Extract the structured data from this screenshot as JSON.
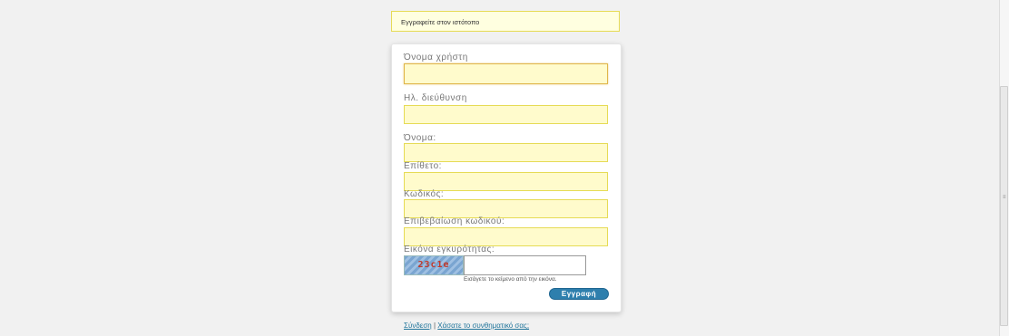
{
  "notice": {
    "text": "Εγγραφείτε στον ιστότοπο"
  },
  "form": {
    "username": {
      "label": "Όνομα χρήστη",
      "value": ""
    },
    "email": {
      "label": "Ηλ. διεύθυνση",
      "value": ""
    },
    "first_name": {
      "label": "Όνομα:",
      "value": ""
    },
    "last_name": {
      "label": "Επίθετο:",
      "value": ""
    },
    "password": {
      "label": "Κωδικός:",
      "value": ""
    },
    "confirm_password": {
      "label": "Επιβεβαίωση κωδικού:",
      "value": ""
    },
    "captcha": {
      "label": "Εικόνα εγκυρότητας:",
      "image_text": "23c1e",
      "value": "",
      "hint": "Εισάγετε το κείμενο από την εικόνα."
    },
    "submit_label": "Εγγραφή"
  },
  "links": {
    "login": "Σύνδεση",
    "separator": "|",
    "lost_password": "Χάσατε το συνθηματικό σας;"
  },
  "scrollbar": {
    "grip": "≡"
  },
  "colors": {
    "background": "#f1f1f1",
    "notice_bg": "#ffffe0",
    "field_bg": "#fffbcc",
    "button": "#2e7fad",
    "link": "#21759b"
  }
}
